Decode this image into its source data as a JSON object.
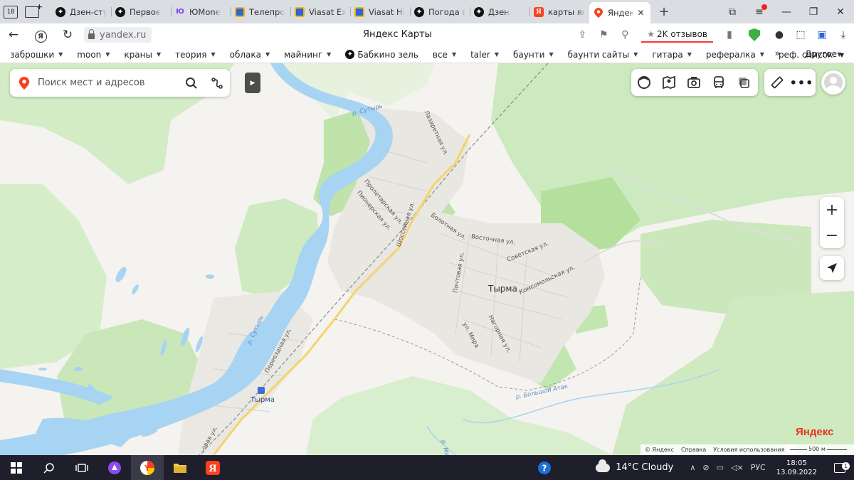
{
  "browser": {
    "tabs": [
      {
        "title": "Дзен-сту",
        "icon": "dzen-icon"
      },
      {
        "title": "Первое",
        "icon": "dzen-icon"
      },
      {
        "title": "ЮMone",
        "icon": "yoomoney-icon"
      },
      {
        "title": "Телепро",
        "icon": "tv-icon"
      },
      {
        "title": "Viasat Ex",
        "icon": "tv-icon"
      },
      {
        "title": "Viasat Hi",
        "icon": "tv-icon"
      },
      {
        "title": "Погода в",
        "icon": "dzen-icon"
      },
      {
        "title": "Дзен",
        "icon": "dzen-icon"
      },
      {
        "title": "карты ян",
        "icon": "yandex-icon"
      },
      {
        "title": "Яндек",
        "icon": "maps-pin-icon",
        "active": true
      }
    ],
    "tab_count_badge": "10",
    "url": "yandex.ru",
    "page_title": "Яндекс Карты",
    "reviews": "2K отзывов"
  },
  "bookmarks": [
    {
      "label": "заброшки"
    },
    {
      "label": "moon"
    },
    {
      "label": "краны"
    },
    {
      "label": "теория"
    },
    {
      "label": "облака"
    },
    {
      "label": "майнинг"
    },
    {
      "label": "Бабкино зелье",
      "display": "Бабкино зель"
    },
    {
      "label": "все"
    },
    {
      "label": "taler"
    },
    {
      "label": "баунти"
    },
    {
      "label": "баунти сайты"
    },
    {
      "label": "гитара"
    },
    {
      "label": "рефералка"
    },
    {
      "label": "реф. список"
    }
  ],
  "bookmarks_more": "Другое",
  "map": {
    "search_placeholder": "Поиск мест и адресов",
    "town_name": "Тырма",
    "station_name": "Тырма",
    "streets": {
      "lazaretnaya": "Лазаретная ул.",
      "proletarskaya": "Пролетарская ул.",
      "pionerskaya": "Пионерская ул.",
      "shosseynaya": "Шоссейная ул.",
      "bolotnaya": "Болотная ул.",
      "vostochnaya": "Восточная ул.",
      "sovetskaya": "Советская ул.",
      "pochtovaya": "Почтовая ул.",
      "komsomolskaya": "Комсомольская ул.",
      "nagornaya": "Нагорная ул.",
      "mira": "ул. Мира",
      "pereezdnaya": "Переездная ул.",
      "vokzalnaya": "...овая ул."
    },
    "rivers": {
      "sutyr_north": "р. Сутырь",
      "sutyr_south": "р. Сутырь",
      "bolshoy_atak": "р. Большой Атак",
      "mal": "р. Ма..."
    },
    "logo": "Яндекс",
    "copyright": [
      "© Яндекс",
      "Справка",
      "Условия использования"
    ],
    "scale_label": "500 м",
    "colors": {
      "water": "#a7d4f2",
      "forest": "#cfeac3",
      "forest_dark": "#a8d98e",
      "town": "#e8e6e1",
      "road": "#f5d36b",
      "accent": "#fc3f1d"
    }
  },
  "taskbar": {
    "weather": "14°C  Cloudy",
    "lang": "РУС",
    "time": "18:05",
    "date": "13.09.2022",
    "notifications": "1"
  }
}
